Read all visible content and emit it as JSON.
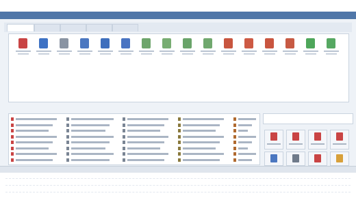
{
  "topbar": {
    "left": "",
    "center": "",
    "right": ""
  },
  "panel_title": "",
  "tabs": [
    {
      "label": "",
      "active": true
    },
    {
      "label": "",
      "active": false
    },
    {
      "label": "",
      "active": false
    },
    {
      "label": "",
      "active": false
    },
    {
      "label": "",
      "active": false
    }
  ],
  "toolbar_icons": [
    {
      "icon": "red-person-icon",
      "label": "",
      "color": "#c94444"
    },
    {
      "icon": "blue-person-icon",
      "label": "",
      "color": "#3e72c4"
    },
    {
      "icon": "gray-person-icon",
      "label": "",
      "color": "#8a94a3"
    },
    {
      "icon": "blue-document-icon",
      "label": "",
      "color": "#4b77c0"
    },
    {
      "icon": "blue-document-icon",
      "label": "",
      "color": "#3f6fbd"
    },
    {
      "icon": "blue-document-icon",
      "label": "",
      "color": "#4a74c2"
    },
    {
      "icon": "green-document-icon",
      "label": "",
      "color": "#6ea56b"
    },
    {
      "icon": "green-document-icon",
      "label": "",
      "color": "#78ad72"
    },
    {
      "icon": "green-document-icon",
      "label": "",
      "color": "#6aa46a"
    },
    {
      "icon": "green-document-icon",
      "label": "",
      "color": "#70a86e"
    },
    {
      "icon": "red-document-icon",
      "label": "",
      "color": "#c8553f"
    },
    {
      "icon": "red-document-icon",
      "label": "",
      "color": "#cd5a44"
    },
    {
      "icon": "red-document-icon",
      "label": "",
      "color": "#c9553f"
    },
    {
      "icon": "red-document-icon",
      "label": "",
      "color": "#c75a43"
    },
    {
      "icon": "green-person-icon",
      "label": "",
      "color": "#4ea65a"
    },
    {
      "icon": "green-person-icon",
      "label": "",
      "color": "#56a862"
    }
  ],
  "left_section": {
    "heading": ""
  },
  "list_columns": [
    {
      "items": [
        {
          "icon_color": "#c94444",
          "text": ""
        },
        {
          "icon_color": "#c94444",
          "text": ""
        },
        {
          "icon_color": "#c94444",
          "text": ""
        },
        {
          "icon_color": "#c94444",
          "text": ""
        },
        {
          "icon_color": "#c94444",
          "text": ""
        },
        {
          "icon_color": "#c94444",
          "text": ""
        },
        {
          "icon_color": "#c94444",
          "text": ""
        },
        {
          "icon_color": "#c94444",
          "text": ""
        }
      ]
    },
    {
      "items": [
        {
          "icon_color": "#7a8594",
          "text": ""
        },
        {
          "icon_color": "#7a8594",
          "text": ""
        },
        {
          "icon_color": "#7a8594",
          "text": ""
        },
        {
          "icon_color": "#7a8594",
          "text": ""
        },
        {
          "icon_color": "#7a8594",
          "text": ""
        },
        {
          "icon_color": "#7a8594",
          "text": ""
        },
        {
          "icon_color": "#7a8594",
          "text": ""
        },
        {
          "icon_color": "#7a8594",
          "text": ""
        }
      ]
    },
    {
      "items": [
        {
          "icon_color": "#7a8594",
          "text": ""
        },
        {
          "icon_color": "#7a8594",
          "text": ""
        },
        {
          "icon_color": "#7a8594",
          "text": ""
        },
        {
          "icon_color": "#7a8594",
          "text": ""
        },
        {
          "icon_color": "#7a8594",
          "text": ""
        },
        {
          "icon_color": "#7a8594",
          "text": ""
        },
        {
          "icon_color": "#7a8594",
          "text": ""
        },
        {
          "icon_color": "#7a8594",
          "text": ""
        }
      ]
    },
    {
      "items": [
        {
          "icon_color": "#8a7a3e",
          "text": ""
        },
        {
          "icon_color": "#8a7a3e",
          "text": ""
        },
        {
          "icon_color": "#8a7a3e",
          "text": ""
        },
        {
          "icon_color": "#8a7a3e",
          "text": ""
        },
        {
          "icon_color": "#8a7a3e",
          "text": ""
        },
        {
          "icon_color": "#8a7a3e",
          "text": ""
        },
        {
          "icon_color": "#8a7a3e",
          "text": ""
        },
        {
          "icon_color": "#8a7a3e",
          "text": ""
        }
      ]
    },
    {
      "items": [
        {
          "icon_color": "#b06a2f",
          "text": ""
        },
        {
          "icon_color": "#b06a2f",
          "text": ""
        },
        {
          "icon_color": "#b06a2f",
          "text": ""
        },
        {
          "icon_color": "#b06a2f",
          "text": ""
        },
        {
          "icon_color": "#b06a2f",
          "text": ""
        },
        {
          "icon_color": "#b06a2f",
          "text": ""
        },
        {
          "icon_color": "#b06a2f",
          "text": ""
        },
        {
          "icon_color": "#b06a2f",
          "text": ""
        }
      ]
    }
  ],
  "right_section": {
    "heading": "",
    "input_value": "",
    "buttons": [
      {
        "icon": "report-icon",
        "label": "",
        "color": "#c94444"
      },
      {
        "icon": "report-icon",
        "label": "",
        "color": "#c94444"
      },
      {
        "icon": "report-icon",
        "label": "",
        "color": "#c94444"
      },
      {
        "icon": "report-icon",
        "label": "",
        "color": "#c94444"
      },
      {
        "icon": "report-icon",
        "label": "",
        "color": "#4b77c0"
      },
      {
        "icon": "report-icon",
        "label": "",
        "color": "#6f7a8a"
      },
      {
        "icon": "report-icon",
        "label": "",
        "color": "#c94444"
      },
      {
        "icon": "report-icon",
        "label": "",
        "color": "#d8a03a"
      }
    ]
  },
  "bottom_panel": {
    "title": ""
  },
  "colors": {
    "accent": "#4f76a8",
    "background": "#eef2f7",
    "panel": "#ffffff",
    "border": "#c9d3df"
  }
}
